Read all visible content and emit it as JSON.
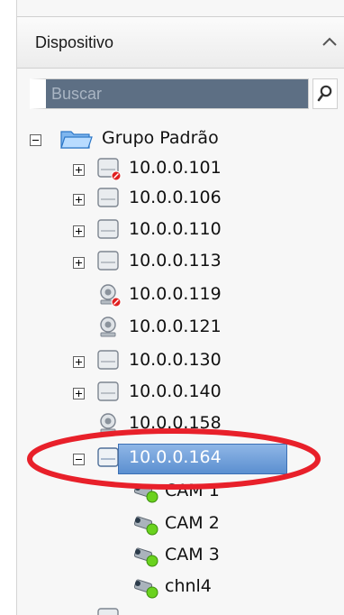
{
  "panel": {
    "title": "Dispositivo",
    "collapse_icon": "chevron-up-icon"
  },
  "search": {
    "placeholder": "Buscar",
    "icon": "search-icon"
  },
  "tree": {
    "group": {
      "label": "Grupo Padrão",
      "expanded": true,
      "icon": "folder-open-icon"
    },
    "devices": [
      {
        "label": "10.0.0.101",
        "type": "dvr",
        "status": "offline",
        "expandable": true
      },
      {
        "label": "10.0.0.106",
        "type": "dvr",
        "status": "online",
        "expandable": true
      },
      {
        "label": "10.0.0.110",
        "type": "dvr",
        "status": "online",
        "expandable": true
      },
      {
        "label": "10.0.0.113",
        "type": "dvr",
        "status": "online",
        "expandable": true
      },
      {
        "label": "10.0.0.119",
        "type": "ip-camera",
        "status": "offline",
        "expandable": false
      },
      {
        "label": "10.0.0.121",
        "type": "ip-camera",
        "status": "online",
        "expandable": false
      },
      {
        "label": "10.0.0.130",
        "type": "dvr",
        "status": "online",
        "expandable": true
      },
      {
        "label": "10.0.0.140",
        "type": "dvr",
        "status": "online",
        "expandable": true
      },
      {
        "label": "10.0.0.158",
        "type": "ip-camera",
        "status": "online",
        "expandable": false
      },
      {
        "label": "10.0.0.164",
        "type": "dvr",
        "status": "online",
        "expandable": true,
        "expanded": true,
        "selected": true
      }
    ],
    "channels": [
      {
        "label": "CAM 1"
      },
      {
        "label": "CAM 2"
      },
      {
        "label": "CAM 3"
      },
      {
        "label": "chnl4"
      }
    ]
  },
  "colors": {
    "search_bg": "#5d6f84",
    "selection": "#5b8fd0",
    "annotation": "#e8202a",
    "online": "#6ad21e",
    "offline": "#e02020"
  }
}
